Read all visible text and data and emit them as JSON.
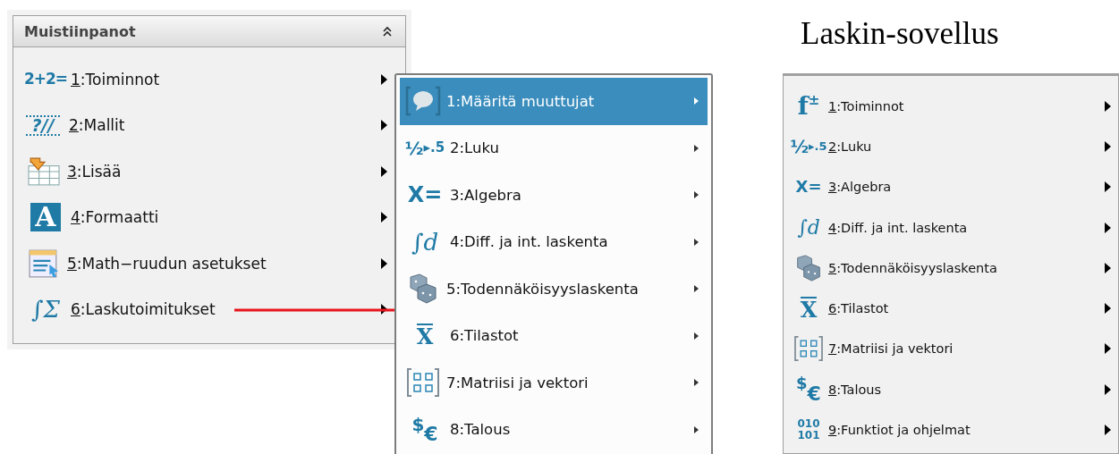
{
  "notes_panel": {
    "title": "Muistiinpanot",
    "underline_keys": true,
    "items": [
      {
        "kind": "calc",
        "glyph": [
          "2+2="
        ],
        "key": "1",
        "text": ":Toiminnot"
      },
      {
        "kind": "template",
        "glyph": [
          "?//"
        ],
        "key": "2",
        "text": ":Mallit"
      },
      {
        "kind": "insert",
        "key": "3",
        "text": ":Lisää"
      },
      {
        "kind": "format",
        "glyph": [
          "A"
        ],
        "key": "4",
        "text": ":Formaatti"
      },
      {
        "kind": "settings",
        "key": "5",
        "text": ":Math−ruudun asetukset"
      },
      {
        "kind": "operations",
        "glyph": [
          "∫Σ"
        ],
        "key": "6",
        "text": ":Laskutoimitukset"
      }
    ]
  },
  "submenu": {
    "underline_keys": false,
    "items": [
      {
        "kind": "variables",
        "key": "1",
        "text": ":Määritä muuttujat",
        "selected": true
      },
      {
        "kind": "number",
        "glyph": [
          "½",
          "▸.5"
        ],
        "key": "2",
        "text": ":Luku",
        "selected": false
      },
      {
        "kind": "algebra",
        "glyph": [
          "X="
        ],
        "key": "3",
        "text": ":Algebra",
        "selected": false
      },
      {
        "kind": "calculus",
        "glyph": [
          "∫d"
        ],
        "key": "4",
        "text": ":Diff. ja int. laskenta",
        "selected": false
      },
      {
        "kind": "probability",
        "key": "5",
        "text": ":Todennäköisyyslaskenta",
        "selected": false
      },
      {
        "kind": "statistics",
        "glyph": [
          "X"
        ],
        "key": "6",
        "text": ":Tilastot",
        "selected": false
      },
      {
        "kind": "matrix",
        "key": "7",
        "text": ":Matriisi ja vektori",
        "selected": false
      },
      {
        "kind": "finance",
        "glyph": [
          "$",
          "€"
        ],
        "key": "8",
        "text": ":Talous",
        "selected": false
      }
    ]
  },
  "calculator": {
    "caption": "Laskin-sovellus",
    "underline_keys": true,
    "items": [
      {
        "kind": "function",
        "glyph": [
          "f",
          "±"
        ],
        "key": "1",
        "text": ":Toiminnot"
      },
      {
        "kind": "number",
        "glyph": [
          "½",
          "▸.5"
        ],
        "key": "2",
        "text": ":Luku"
      },
      {
        "kind": "algebra",
        "glyph": [
          "X="
        ],
        "key": "3",
        "text": ":Algebra"
      },
      {
        "kind": "calculus",
        "glyph": [
          "∫d"
        ],
        "key": "4",
        "text": ":Diff. ja int. laskenta"
      },
      {
        "kind": "probability",
        "key": "5",
        "text": ":Todennäköisyyslaskenta"
      },
      {
        "kind": "statistics",
        "glyph": [
          "X"
        ],
        "key": "6",
        "text": ":Tilastot"
      },
      {
        "kind": "matrix",
        "key": "7",
        "text": ":Matriisi ja vektori"
      },
      {
        "kind": "finance",
        "glyph": [
          "$",
          "€"
        ],
        "key": "8",
        "text": ":Talous"
      },
      {
        "kind": "functions",
        "glyph": [
          "010",
          "101"
        ],
        "key": "9",
        "text": ":Funktiot ja ohjelmat"
      }
    ]
  }
}
